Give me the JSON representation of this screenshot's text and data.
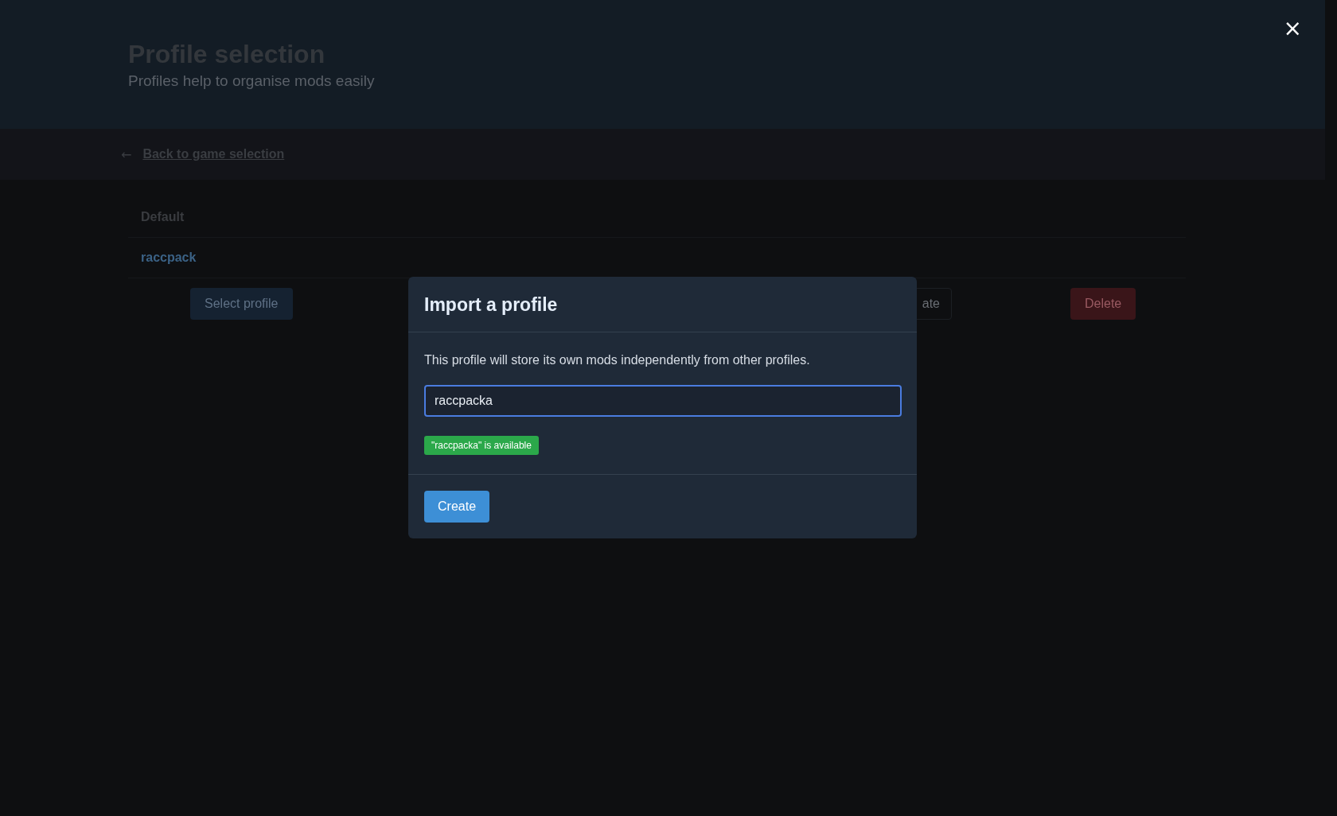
{
  "header": {
    "title": "Profile selection",
    "subtitle": "Profiles help to organise mods easily",
    "close": "×"
  },
  "nav": {
    "arrow": "←",
    "link": "Back to game selection"
  },
  "profiles": [
    {
      "name": "Default",
      "selected": false
    },
    {
      "name": "raccpack",
      "selected": true
    }
  ],
  "actions": [
    {
      "label": "Select profile",
      "kind": "primary"
    },
    {
      "label": "ate",
      "kind": "outline"
    },
    {
      "label": "Delete",
      "kind": "danger"
    }
  ],
  "modal": {
    "title": "Import a profile",
    "description": "This profile will store its own mods independently from other profiles.",
    "input": {
      "value": "raccpacka"
    },
    "status": "\"raccpacka\" is available",
    "button": "Create"
  }
}
